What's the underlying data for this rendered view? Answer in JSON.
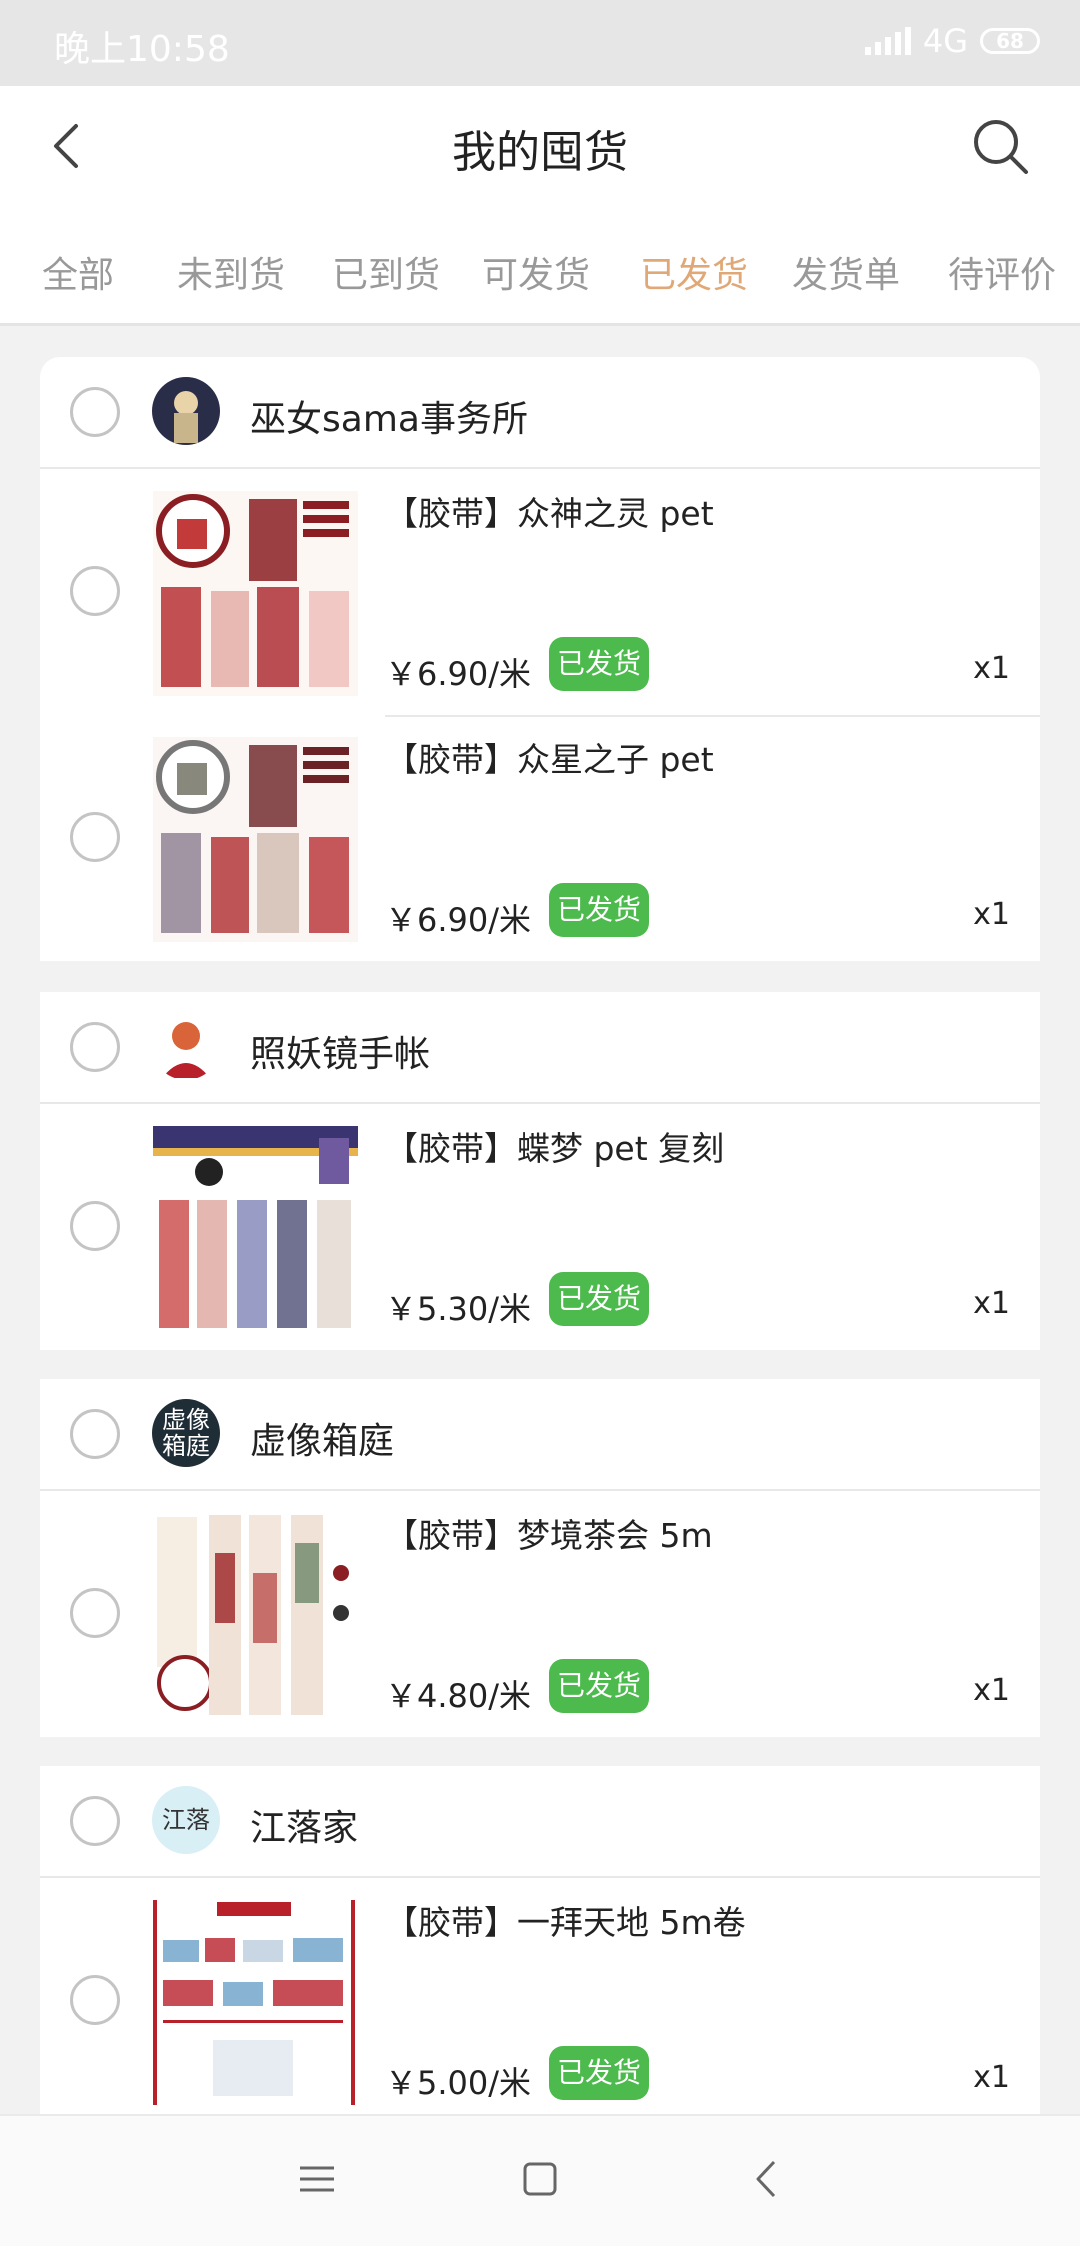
{
  "status_bar": {
    "time": "晚上10:58",
    "network": "4G",
    "battery": "68"
  },
  "header": {
    "title": "我的囤货",
    "back_icon": "chevron-left-icon",
    "search_icon": "search-icon"
  },
  "tabs": [
    {
      "label": "全部",
      "active": false
    },
    {
      "label": "未到货",
      "active": false
    },
    {
      "label": "已到货",
      "active": false
    },
    {
      "label": "可发货",
      "active": false
    },
    {
      "label": "已发货",
      "active": true
    },
    {
      "label": "发货单",
      "active": false
    },
    {
      "label": "待评价",
      "active": false
    }
  ],
  "colors": {
    "accent": "#e0a877",
    "badge": "#4dba4d",
    "tab_inactive": "#999999"
  },
  "shops": [
    {
      "name": "巫女sama事务所",
      "items": [
        {
          "title": "【胶带】众神之灵 pet",
          "price": "￥6.90/米",
          "status": "已发货",
          "qty": "x1"
        },
        {
          "title": "【胶带】众星之子 pet",
          "price": "￥6.90/米",
          "status": "已发货",
          "qty": "x1"
        }
      ]
    },
    {
      "name": "照妖镜手帐",
      "items": [
        {
          "title": "【胶带】蝶梦 pet 复刻",
          "price": "￥5.30/米",
          "status": "已发货",
          "qty": "x1"
        }
      ]
    },
    {
      "name": "虚像箱庭",
      "avatar_text": "虚像箱庭",
      "items": [
        {
          "title": "【胶带】梦境茶会 5m",
          "price": "￥4.80/米",
          "status": "已发货",
          "qty": "x1"
        }
      ]
    },
    {
      "name": "江落家",
      "avatar_text": "江落",
      "items": [
        {
          "title": "【胶带】一拜天地 5m卷",
          "price": "￥5.00/米",
          "status": "已发货",
          "qty": "x1"
        }
      ]
    }
  ],
  "nav_bar": {
    "menu_icon": "menu-icon",
    "home_icon": "home-square-icon",
    "back_icon": "back-triangle-icon"
  }
}
